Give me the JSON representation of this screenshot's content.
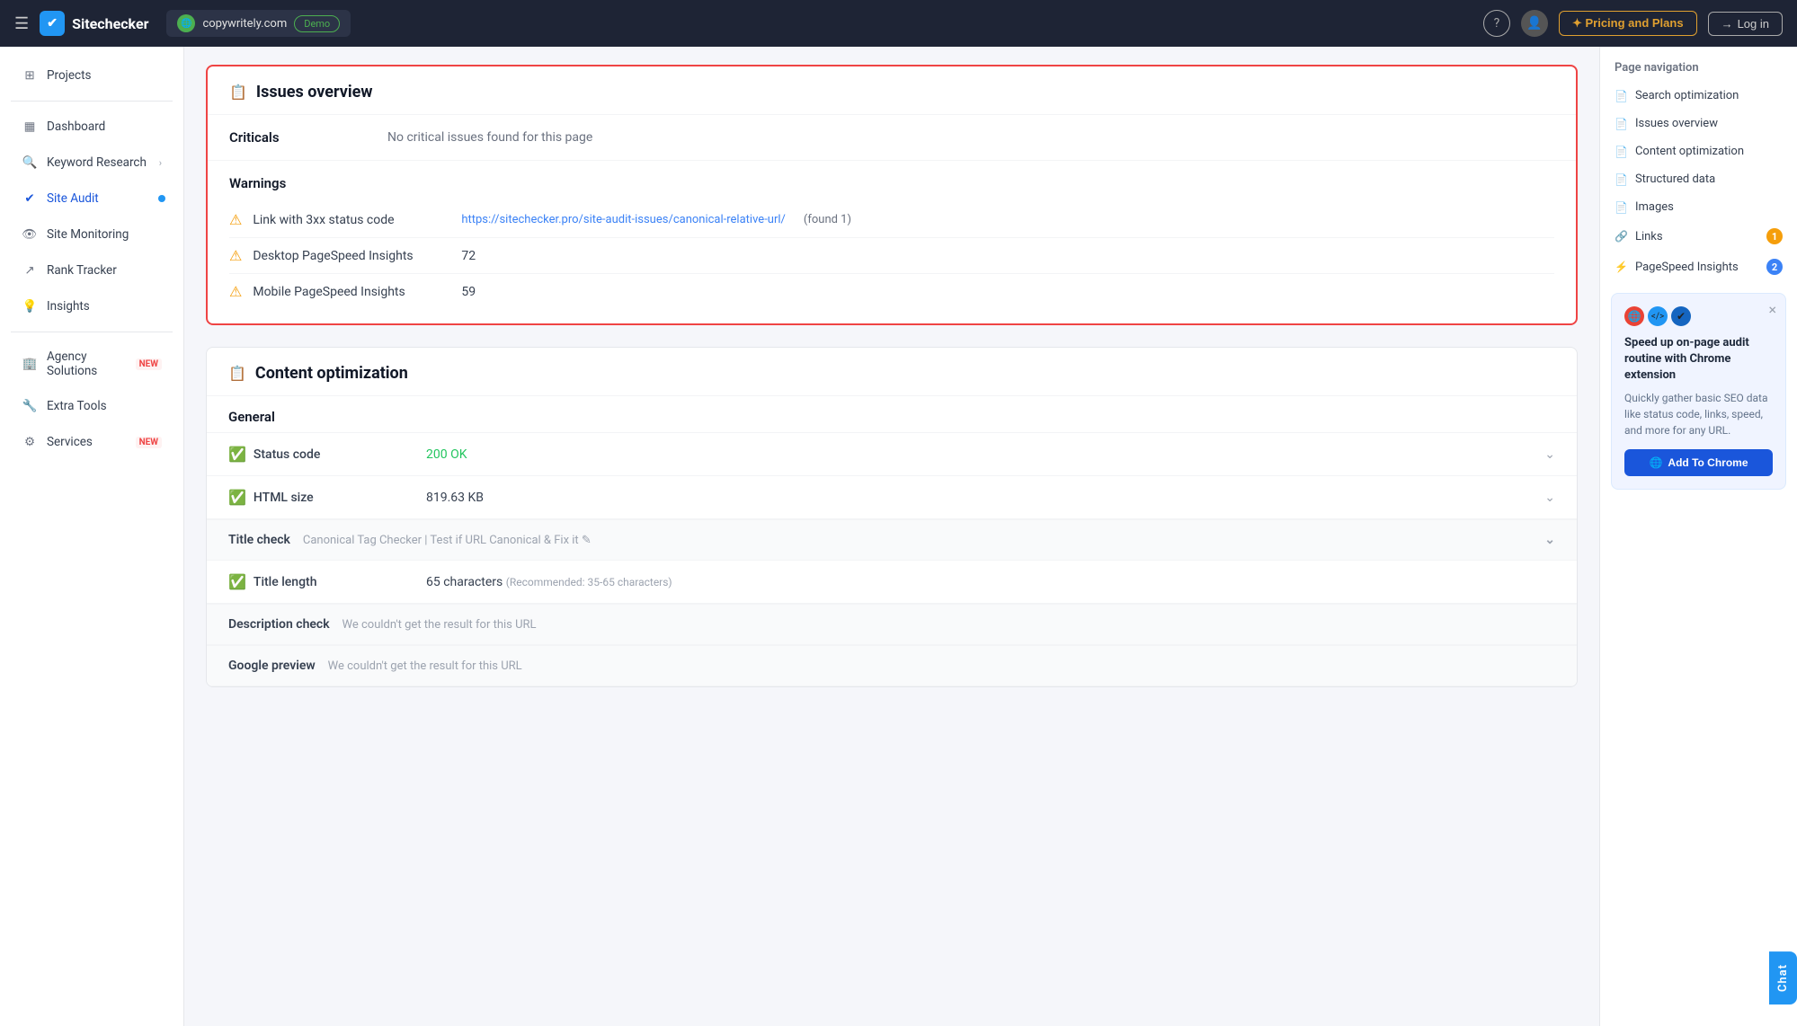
{
  "topnav": {
    "logo_text": "Sitechecker",
    "site_name": "copywritely.com",
    "demo_badge": "Demo",
    "help_icon": "?",
    "pricing_label": "✦ Pricing and Plans",
    "login_label": "Log in",
    "hamburger": "☰"
  },
  "sidebar": {
    "items": [
      {
        "id": "projects",
        "label": "Projects",
        "icon": "⊞",
        "active": false
      },
      {
        "id": "dashboard",
        "label": "Dashboard",
        "icon": "▦",
        "active": false
      },
      {
        "id": "keyword-research",
        "label": "Keyword Research",
        "icon": "🔍",
        "active": false,
        "chevron": true
      },
      {
        "id": "site-audit",
        "label": "Site Audit",
        "icon": "✔",
        "active": true,
        "badge_blue": true
      },
      {
        "id": "site-monitoring",
        "label": "Site Monitoring",
        "icon": "👁",
        "active": false
      },
      {
        "id": "rank-tracker",
        "label": "Rank Tracker",
        "icon": "↗",
        "active": false
      },
      {
        "id": "insights",
        "label": "Insights",
        "icon": "💡",
        "active": false
      },
      {
        "id": "agency-solutions",
        "label": "Agency Solutions",
        "new": true,
        "icon": "🏢",
        "active": false
      },
      {
        "id": "extra-tools",
        "label": "Extra Tools",
        "icon": "🔧",
        "active": false
      },
      {
        "id": "services",
        "label": "Services",
        "new": true,
        "icon": "⚙",
        "active": false
      }
    ]
  },
  "page_nav": {
    "title": "Page navigation",
    "items": [
      {
        "id": "search-optimization",
        "label": "Search optimization",
        "icon": "📄"
      },
      {
        "id": "issues-overview",
        "label": "Issues overview",
        "icon": "📄"
      },
      {
        "id": "content-optimization",
        "label": "Content optimization",
        "icon": "📄"
      },
      {
        "id": "structured-data",
        "label": "Structured data",
        "icon": "📄"
      },
      {
        "id": "images",
        "label": "Images",
        "icon": "📄"
      },
      {
        "id": "links",
        "label": "Links",
        "icon": "🔗",
        "badge": "1",
        "badge_color": "orange"
      },
      {
        "id": "pagespeed-insights",
        "label": "PageSpeed Insights",
        "icon": "⚡",
        "badge": "2",
        "badge_color": "blue"
      }
    ]
  },
  "chrome_promo": {
    "title": "Speed up on-page audit routine with Chrome extension",
    "description": "Quickly gather basic SEO data like status code, links, speed, and more for any URL.",
    "button_label": "Add To Chrome",
    "close_icon": "×"
  },
  "issues_overview": {
    "title": "Issues overview",
    "criticals_label": "Criticals",
    "criticals_value": "No critical issues found for this page",
    "warnings_label": "Warnings",
    "warnings": [
      {
        "label": "Link with 3xx status code",
        "link": "https://sitechecker.pro/site-audit-issues/canonical-relative-url/",
        "found": "(found 1)"
      },
      {
        "label": "Desktop PageSpeed Insights",
        "value": "72"
      },
      {
        "label": "Mobile PageSpeed Insights",
        "value": "59"
      }
    ]
  },
  "content_optimization": {
    "title": "Content optimization",
    "general_label": "General",
    "rows_general": [
      {
        "label": "Status code",
        "value": "200 OK",
        "value_class": "green",
        "check": true,
        "expandable": true
      },
      {
        "label": "HTML size",
        "value": "819.63 KB",
        "check": true,
        "expandable": true
      }
    ],
    "title_check_label": "Title check",
    "title_check_value": "Canonical Tag Checker | Test if URL Canonical & Fix it ✎",
    "rows_title": [
      {
        "label": "Title length",
        "value": "65 characters",
        "recommended": "(Recommended: 35-65 characters)",
        "check": true,
        "expandable": false
      }
    ],
    "description_check_label": "Description check",
    "description_check_value": "We couldn't get the result for this URL",
    "google_preview_label": "Google preview",
    "google_preview_value": "We couldn't get the result for this URL"
  },
  "chat_bubble": {
    "label": "Chat"
  }
}
